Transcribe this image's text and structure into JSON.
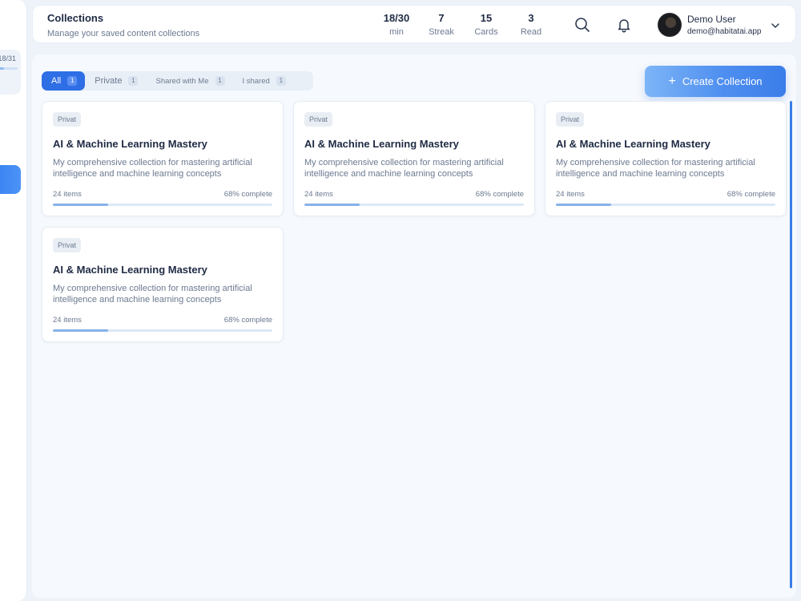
{
  "sidebar": {
    "goal_text": "18/31",
    "goal_progress": 0.58
  },
  "header": {
    "title": "Collections",
    "subtitle": "Manage your saved content collections",
    "stats": [
      {
        "value": "18/30",
        "label": "min"
      },
      {
        "value": "7",
        "label": "Streak"
      },
      {
        "value": "15",
        "label": "Cards"
      },
      {
        "value": "3",
        "label": "Read"
      }
    ],
    "icons": [
      "search-icon",
      "bell-icon",
      "chevron-down-icon"
    ],
    "user": {
      "name": "Demo User",
      "email": "demo@habitatai.app"
    }
  },
  "tabs": [
    {
      "label": "All",
      "count": "1",
      "active": true
    },
    {
      "label": "Private",
      "count": "1",
      "active": false
    },
    {
      "label": "Shared with Me",
      "count": "1",
      "active": false
    },
    {
      "label": "I shared",
      "count": "1",
      "active": false
    }
  ],
  "create_button": {
    "label": "Create Collection",
    "icon": "plus-icon"
  },
  "collections": [
    {
      "badge": "Privat",
      "title": "AI & Machine Learning Mastery",
      "description": "My comprehensive collection for mastering artificial intelligence and machine learning concepts",
      "items": "24 items",
      "completion_label": "68% complete",
      "progress": 0.25
    },
    {
      "badge": "Privat",
      "title": "AI & Machine Learning Mastery",
      "description": "My comprehensive collection for mastering artificial intelligence and machine learning concepts",
      "items": "24 items",
      "completion_label": "68% complete",
      "progress": 0.25
    },
    {
      "badge": "Privat",
      "title": "AI & Machine Learning Mastery",
      "description": "My comprehensive collection for mastering artificial intelligence and machine learning concepts",
      "items": "24 items",
      "completion_label": "68% complete",
      "progress": 0.25
    },
    {
      "badge": "Privat",
      "title": "AI & Machine Learning Mastery",
      "description": "My comprehensive collection for mastering artificial intelligence and machine learning concepts",
      "items": "24 items",
      "completion_label": "68% complete",
      "progress": 0.25
    }
  ],
  "colors": {
    "accent": "#2f6fe6",
    "page_bg": "#eef3f9",
    "progress_track": "#dbe8f7",
    "progress_fill": "#87b1ea"
  }
}
